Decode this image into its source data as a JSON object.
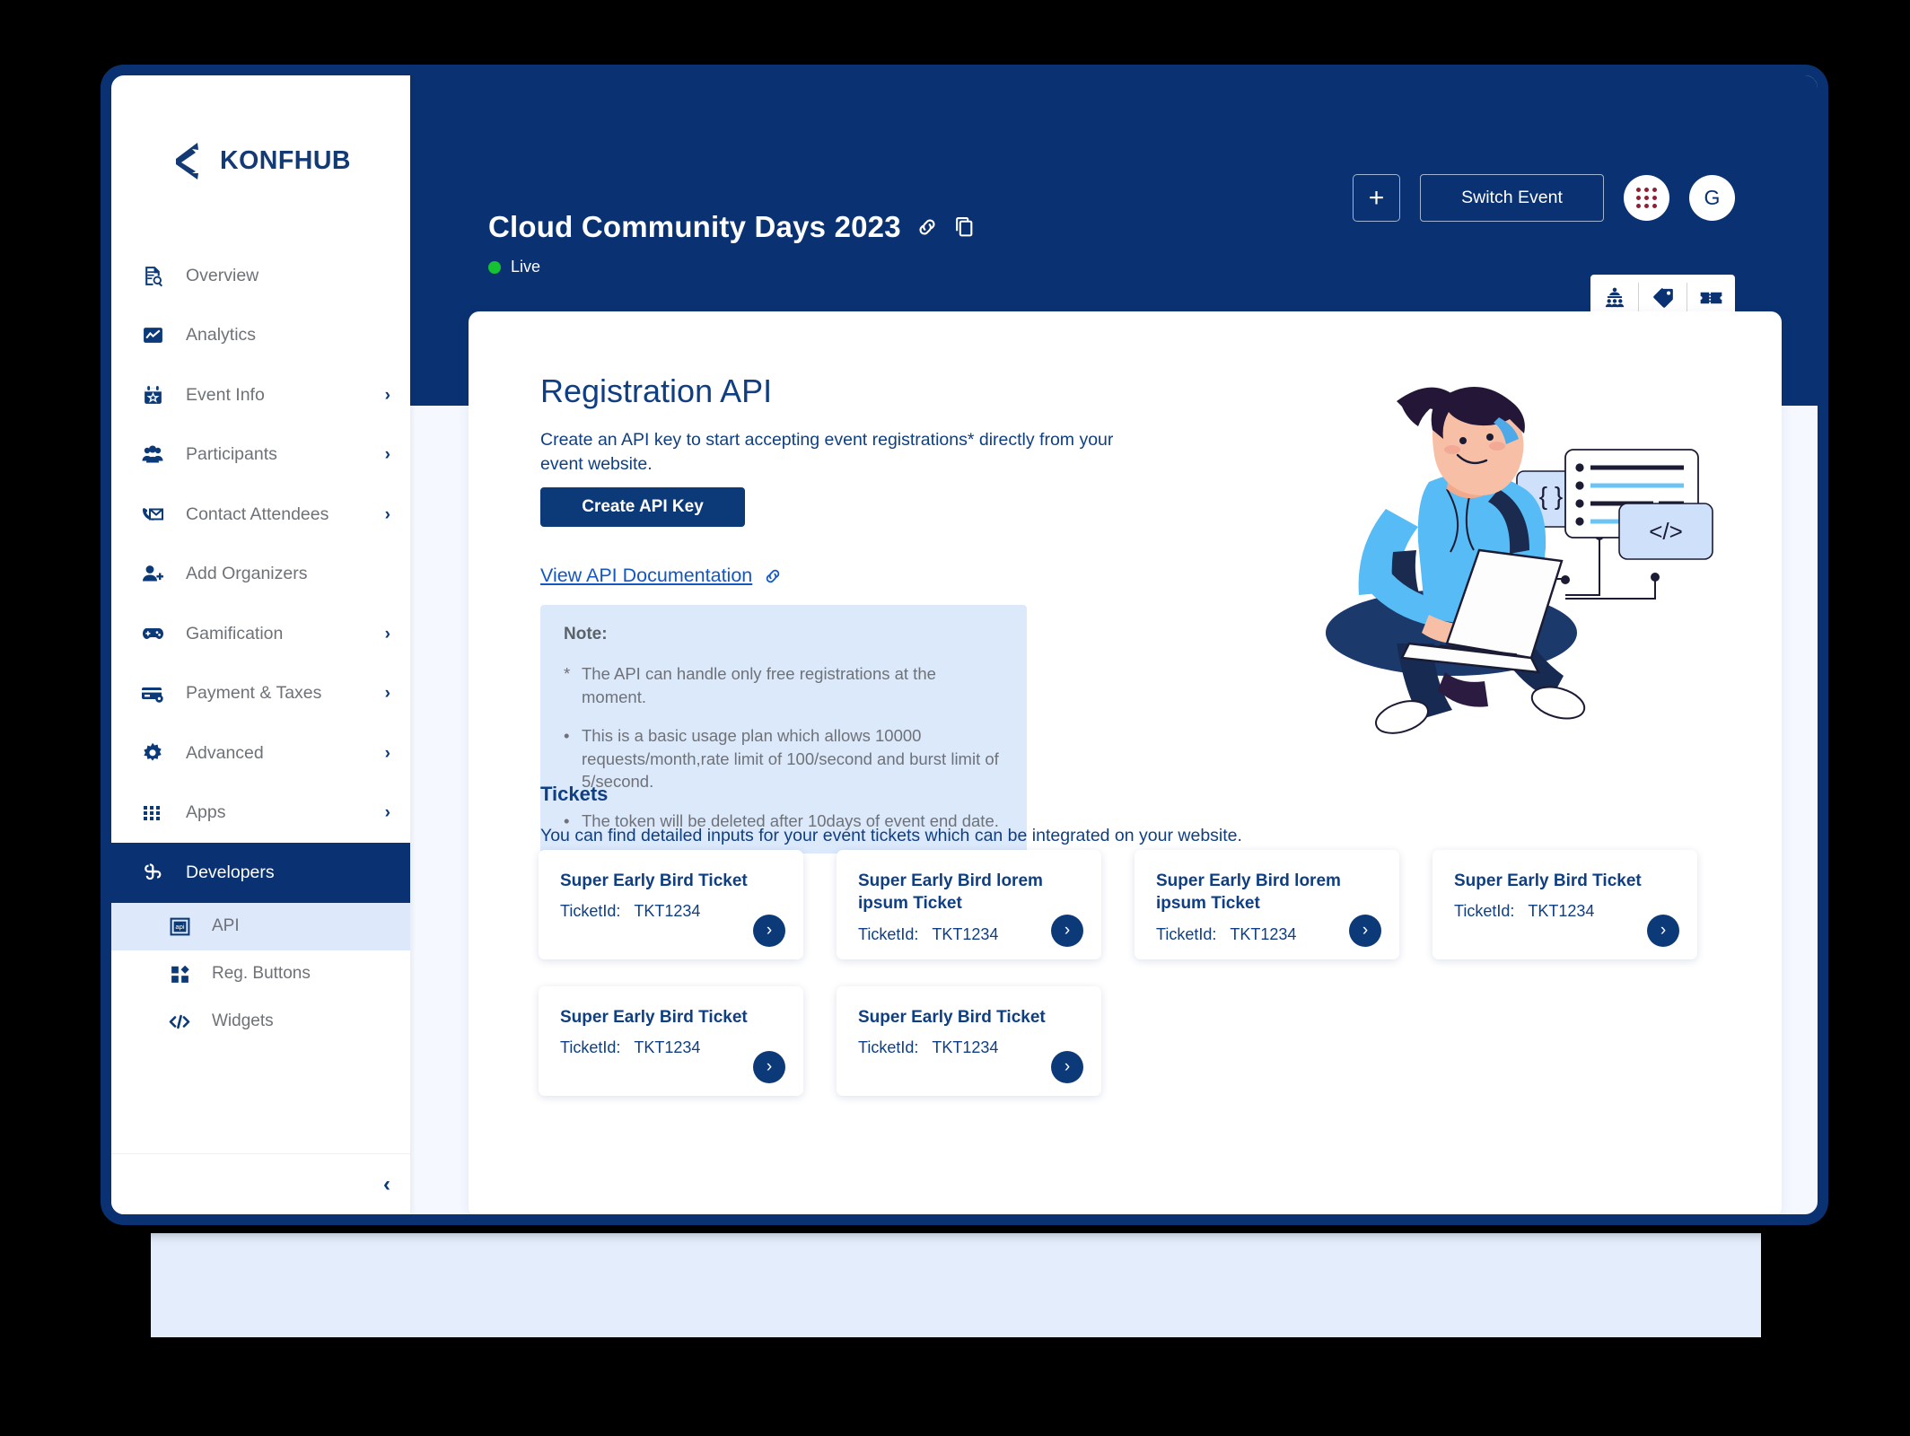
{
  "brand": {
    "name": "KONFHUB",
    "logo_icon": "konfhub-logo-mark"
  },
  "header": {
    "event_title": "Cloud Community Days 2023",
    "link_icon": "link-icon",
    "copy_icon": "copy-icon",
    "status_label": "Live",
    "status_color": "#16c132",
    "plus_label": "+",
    "switch_event_label": "Switch Event",
    "apps_icon": "apps-grid-icon",
    "avatar_initial": "G",
    "actions": [
      {
        "icon": "conference-icon",
        "name": "conference"
      },
      {
        "icon": "tag-icon",
        "name": "tag"
      },
      {
        "icon": "ticket-icon",
        "name": "ticket"
      }
    ]
  },
  "sidebar": {
    "items": [
      {
        "label": "Overview",
        "icon": "document-search-icon",
        "chevron": "",
        "active": false
      },
      {
        "label": "Analytics",
        "icon": "analytics-chart-icon",
        "chevron": "",
        "active": false
      },
      {
        "label": "Event Info",
        "icon": "calendar-star-icon",
        "chevron": "›",
        "active": false
      },
      {
        "label": "Participants",
        "icon": "people-group-icon",
        "chevron": "›",
        "active": false
      },
      {
        "label": "Contact Attendees",
        "icon": "mail-phone-icon",
        "chevron": "›",
        "active": false
      },
      {
        "label": "Add Organizers",
        "icon": "user-plus-icon",
        "chevron": "",
        "active": false
      },
      {
        "label": "Gamification",
        "icon": "gamepad-icon",
        "chevron": "›",
        "active": false
      },
      {
        "label": "Payment & Taxes",
        "icon": "credit-card-gear-icon",
        "chevron": "›",
        "active": false
      },
      {
        "label": "Advanced",
        "icon": "gear-icon",
        "chevron": "›",
        "active": false
      },
      {
        "label": "Apps",
        "icon": "grid-apps-icon",
        "chevron": "›",
        "active": false
      },
      {
        "label": "Developers",
        "icon": "developers-puzzle-icon",
        "chevron": "",
        "active": true
      }
    ],
    "sub_items": [
      {
        "label": "API",
        "icon": "api-box-icon",
        "selected": true
      },
      {
        "label": "Reg. Buttons",
        "icon": "reg-buttons-icon",
        "selected": false
      },
      {
        "label": "Widgets",
        "icon": "code-tag-icon",
        "selected": false
      }
    ],
    "collapse_icon": "chevron-left-icon"
  },
  "main": {
    "page_title": "Registration API",
    "page_description": "Create an API key to start accepting event registrations* directly from your event website.",
    "create_key_label": "Create API Key",
    "doc_link_label": "View API Documentation",
    "doc_link_icon": "link-icon",
    "note": {
      "title": "Note:",
      "lines": [
        {
          "bullet": "*",
          "text": "The API can handle only free registrations at the moment."
        },
        {
          "bullet": "•",
          "text": "This is a basic usage plan which allows 10000 requests/month,rate limit of 100/second and burst limit of 5/second."
        },
        {
          "bullet": "•",
          "text": "The token will be deleted after 10days of event end date."
        }
      ]
    },
    "tickets_title": "Tickets",
    "tickets_description": "You can find detailed inputs for your event tickets which can be integrated on your website.",
    "ticket_id_label": "TicketId:",
    "tickets": [
      {
        "name": "Super Early Bird Ticket",
        "ticket_id": "TKT1234"
      },
      {
        "name": "Super Early Bird lorem ipsum Ticket",
        "ticket_id": "TKT1234"
      },
      {
        "name": "Super Early Bird lorem ipsum Ticket",
        "ticket_id": "TKT1234"
      },
      {
        "name": "Super Early Bird Ticket",
        "ticket_id": "TKT1234"
      },
      {
        "name": "Super Early Bird Ticket",
        "ticket_id": "TKT1234"
      },
      {
        "name": "Super Early Bird Ticket",
        "ticket_id": "TKT1234"
      }
    ],
    "illustration": "developer-coding-illustration"
  },
  "colors": {
    "navy": "#0a3272",
    "accent_blue": "#1557c0",
    "note_bg": "#dce9fb",
    "live_green": "#16c132"
  }
}
